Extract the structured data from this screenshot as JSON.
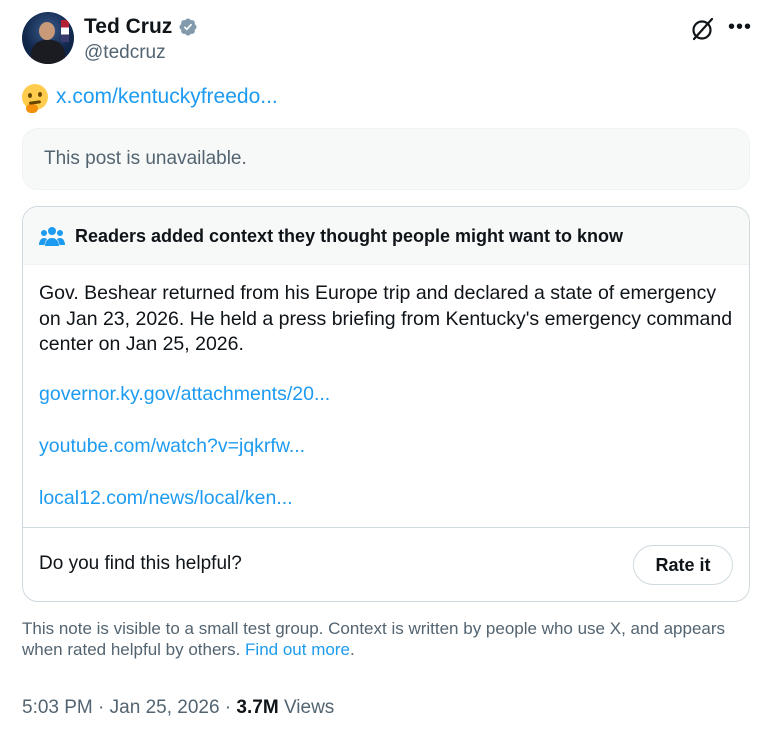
{
  "author": {
    "name": "Ted Cruz",
    "handle": "@tedcruz",
    "verified_icon": "verified-badge-icon",
    "verified_color": "#829aab"
  },
  "tweet": {
    "emoji": "thinking-face",
    "link_text": "x.com/kentuckyfreedo..."
  },
  "quoted_post": {
    "text": "This post is unavailable."
  },
  "community_note": {
    "title": "Readers added context they thought people might want to know",
    "body": "Gov. Beshear returned from his Europe trip and declared a state of emergency on Jan 23, 2026. He held a press briefing from Kentucky's emergency command center on Jan 25, 2026.",
    "links": [
      "governor.ky.gov/attachments/20...",
      "youtube.com/watch?v=jqkrfw...",
      "local12.com/news/local/ken..."
    ],
    "helpful_prompt": "Do you find this helpful?",
    "rate_label": "Rate it"
  },
  "disclaimer": {
    "text": "This note is visible to a small test group. Context is written by people who use X, and appears when rated helpful by others.",
    "find_out_more": "Find out more",
    "period": "."
  },
  "meta": {
    "time": "5:03 PM",
    "separator": " · ",
    "date": "Jan 25, 2026",
    "views_count": "3.7M",
    "views_label": "Views"
  },
  "colors": {
    "accent": "#1d9bf0",
    "text": "#0f1419",
    "secondary": "#536471",
    "border": "#cfd9de"
  }
}
